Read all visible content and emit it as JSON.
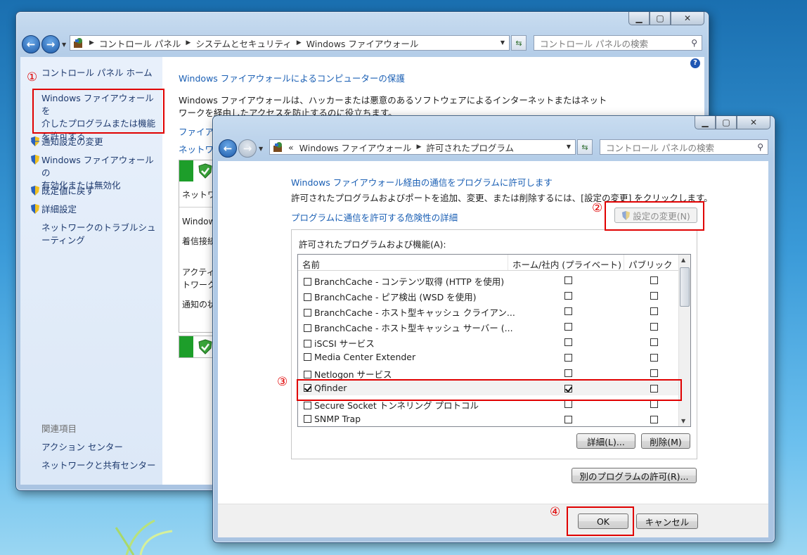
{
  "back_window": {
    "address": {
      "crumbs": [
        "コントロール パネル",
        "システムとセキュリティ",
        "Windows ファイアウォール"
      ]
    },
    "search_placeholder": "コントロール パネルの検索",
    "sidebar": {
      "home": "コントロール パネル ホーム",
      "allow_programs": [
        "Windows ファイアウォールを",
        "介したプログラムまたは機能",
        "を許可する"
      ],
      "items": [
        "通知設定の変更",
        "Windows ファイアウォールの",
        "有効化または無効化",
        "既定値に戻す",
        "詳細設定"
      ],
      "troubleshoot": [
        "ネットワークのトラブルシュ",
        "ーティング"
      ],
      "related_title": "関連項目",
      "related": [
        "アクション センター",
        "ネットワークと共有センター"
      ]
    },
    "main": {
      "title": "Windows ファイアウォールによるコンピューターの保護",
      "desc": [
        "Windows ファイアウォールは、ハッカーまたは悪意のあるソフトウェアによるインターネットまたはネット",
        "ワークを経由したアクセスを防止するのに役立ちます。"
      ],
      "link1": "ファイア",
      "link2": "ネットワ",
      "net_label": "ネットワ",
      "panel_lines": [
        "Window",
        "着信接続",
        "アクティ",
        "トワーク",
        "通知の状"
      ]
    }
  },
  "front_window": {
    "address": {
      "prefix": "«",
      "crumbs": [
        "Windows ファイアウォール",
        "許可されたプログラム"
      ]
    },
    "search_placeholder": "コントロール パネルの検索",
    "title": "Windows ファイアウォール経由の通信をプログラムに許可します",
    "desc": "許可されたプログラムおよびポートを追加、変更、または削除するには、[設定の変更] をクリックします。",
    "risk_link": "プログラムに通信を許可する危険性の詳細",
    "change_settings": "設定の変更(N)",
    "group_label": "許可されたプログラムおよび機能(A):",
    "columns": [
      "名前",
      "ホーム/社内 (プライベート)",
      "パブリック"
    ],
    "rows": [
      {
        "name": "BranchCache - コンテンツ取得 (HTTP を使用)",
        "on": false,
        "private": false,
        "public": false
      },
      {
        "name": "BranchCache - ピア検出 (WSD を使用)",
        "on": false,
        "private": false,
        "public": false
      },
      {
        "name": "BranchCache - ホスト型キャッシュ クライアン...",
        "on": false,
        "private": false,
        "public": false
      },
      {
        "name": "BranchCache - ホスト型キャッシュ サーバー (...",
        "on": false,
        "private": false,
        "public": false
      },
      {
        "name": "iSCSI サービス",
        "on": false,
        "private": false,
        "public": false
      },
      {
        "name": "Media Center Extender",
        "on": false,
        "private": false,
        "public": false
      },
      {
        "name": "Netlogon サービス",
        "on": false,
        "private": false,
        "public": false
      },
      {
        "name": "Qfinder",
        "on": true,
        "private": true,
        "public": false
      },
      {
        "name": "Secure Socket トンネリング プロトコル",
        "on": false,
        "private": false,
        "public": false
      },
      {
        "name": "SNMP Trap",
        "on": false,
        "private": false,
        "public": false
      }
    ],
    "details_btn": "詳細(L)...",
    "remove_btn": "削除(M)",
    "allow_other_btn": "別のプログラムの許可(R)...",
    "ok_btn": "OK",
    "cancel_btn": "キャンセル"
  },
  "annotations": {
    "m1": "①",
    "m2": "②",
    "m3": "③",
    "m4": "④"
  },
  "colors": {
    "annotation": "#e00000",
    "link": "#1a5fb4"
  }
}
